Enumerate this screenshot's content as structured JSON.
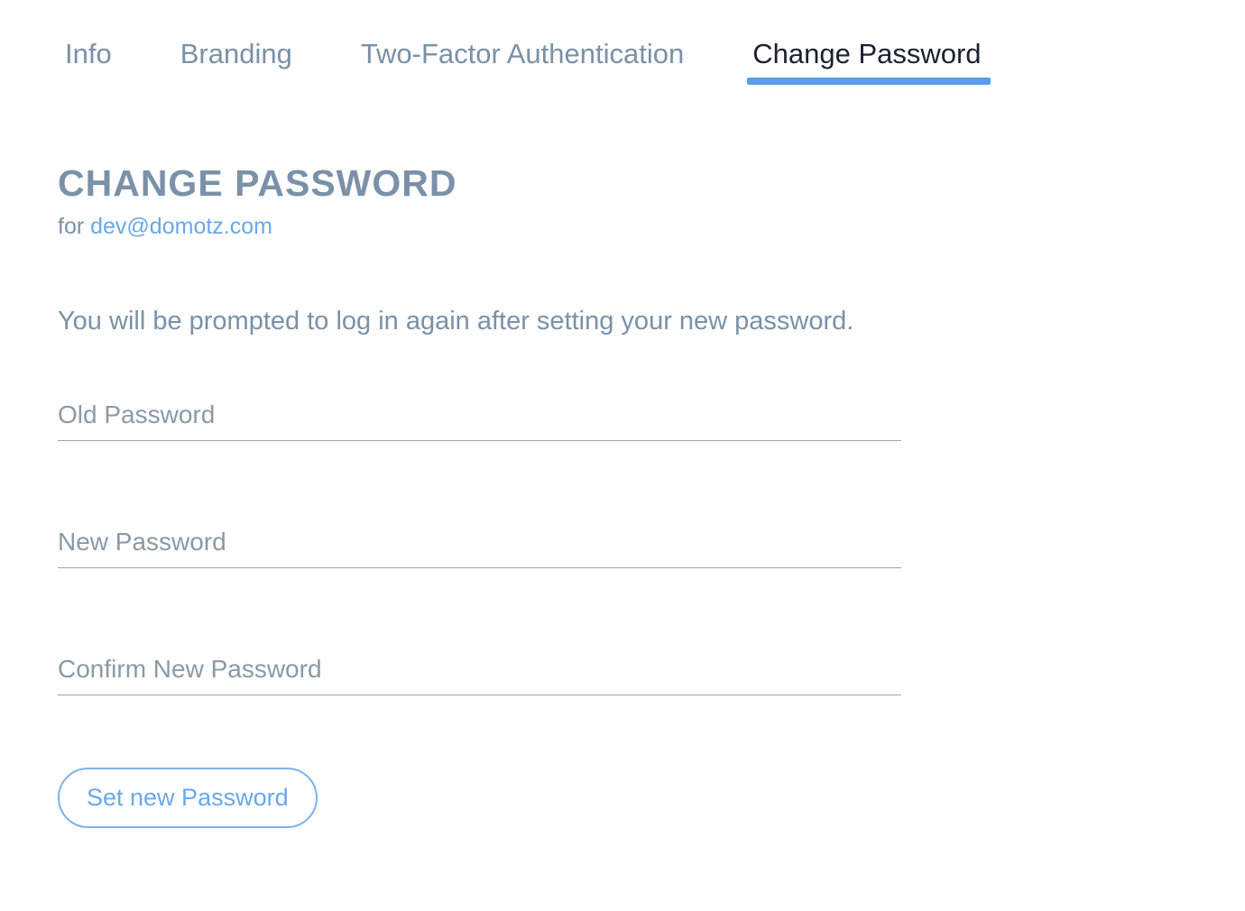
{
  "tabs": [
    {
      "label": "Info",
      "active": false
    },
    {
      "label": "Branding",
      "active": false
    },
    {
      "label": "Two-Factor Authentication",
      "active": false
    },
    {
      "label": "Change Password",
      "active": true
    }
  ],
  "page": {
    "title": "CHANGE PASSWORD",
    "for_prefix": "for ",
    "email": "dev@domotz.com",
    "info": "You will be prompted to log in again after setting your new password."
  },
  "form": {
    "old_password": {
      "placeholder": "Old Password",
      "value": ""
    },
    "new_password": {
      "placeholder": "New Password",
      "value": ""
    },
    "confirm_password": {
      "placeholder": "Confirm New Password",
      "value": ""
    },
    "submit_label": "Set new Password"
  }
}
